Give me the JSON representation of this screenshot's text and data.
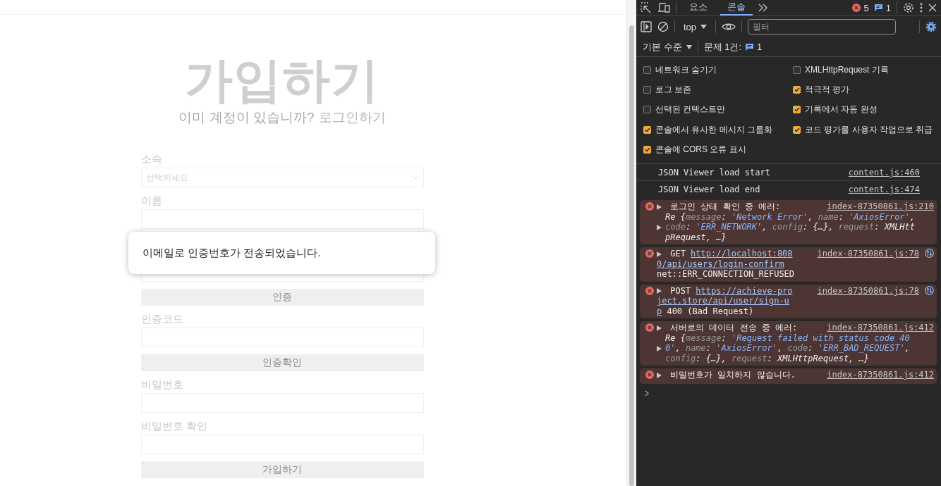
{
  "page": {
    "title": "가입하기",
    "subtitle": "이미 계정이 있습니까?",
    "login_link": "로그인하기",
    "form": [
      {
        "kind": "select",
        "label": "소속",
        "placeholder": "선택하세요"
      },
      {
        "kind": "input",
        "label": "이름"
      },
      {
        "kind": "input"
      },
      {
        "kind": "button",
        "label": "인증"
      },
      {
        "kind": "input",
        "label": "인증코드"
      },
      {
        "kind": "button",
        "label": "인증확인"
      },
      {
        "kind": "input",
        "label": "비밀번호"
      },
      {
        "kind": "input",
        "label": "비밀번호 확인"
      },
      {
        "kind": "button",
        "label": "가입하기"
      }
    ],
    "toast": {
      "message": "이메일로 인증번호가 전송되었습니다."
    }
  },
  "devtools": {
    "tabs": [
      {
        "label": "요소",
        "selected": false
      },
      {
        "label": "콘솔",
        "selected": true
      }
    ],
    "error_count": "5",
    "issue_count": "1",
    "context": "top",
    "filter": {
      "placeholder": "필터"
    },
    "level_menu": "기본 수준",
    "issues_label": "문제 1건:",
    "issues_count": "1",
    "settings": [
      {
        "label": "네트워크 숨기기",
        "checked": false
      },
      {
        "label": "XMLHttpRequest 기록",
        "checked": false
      },
      {
        "label": "로그 보존",
        "checked": false
      },
      {
        "label": "적극적 평가",
        "checked": true
      },
      {
        "label": "선택된 컨텍스트만",
        "checked": false
      },
      {
        "label": "기록에서 자동 완성",
        "checked": true
      },
      {
        "label": "콘솔에서 유사한 메시지 그룹화",
        "checked": true
      },
      {
        "label": "코드 평가를 사용자 작업으로 취급",
        "checked": true
      },
      {
        "label": "콘솔에 CORS 오류 표시",
        "checked": true
      }
    ],
    "messages": [
      {
        "kind": "info",
        "text": "JSON Viewer load start",
        "source": "content.js:460"
      },
      {
        "kind": "info",
        "text": "JSON Viewer load end",
        "source": "content.js:474"
      },
      {
        "kind": "error",
        "source": "index-87350861.js:210",
        "network": false,
        "lines": [
          {
            "kind": "head",
            "expander": true,
            "segments": [
              {
                "kind": "text",
                "text": "로그인 상태 확인 중 에러:"
              }
            ]
          },
          {
            "kind": "object",
            "expander": false,
            "segments": [
              {
                "kind": "value",
                "text": "Re {"
              },
              {
                "kind": "key",
                "text": "message"
              },
              {
                "kind": "value",
                "text": ": "
              },
              {
                "kind": "string",
                "text": "'Network Error'"
              },
              {
                "kind": "value",
                "text": ", "
              },
              {
                "kind": "key",
                "text": "name"
              },
              {
                "kind": "value",
                "text": ": "
              },
              {
                "kind": "string",
                "text": "'AxiosError'"
              },
              {
                "kind": "value",
                "text": ","
              }
            ]
          },
          {
            "kind": "object",
            "expander": true,
            "segments": [
              {
                "kind": "key",
                "text": "code"
              },
              {
                "kind": "value",
                "text": ": "
              },
              {
                "kind": "string",
                "text": "'ERR_NETWORK'"
              },
              {
                "kind": "value",
                "text": ", "
              },
              {
                "kind": "key",
                "text": "config"
              },
              {
                "kind": "value",
                "text": ": {…}, "
              },
              {
                "kind": "key",
                "text": "request"
              },
              {
                "kind": "value",
                "text": ": XMLHtt"
              }
            ]
          },
          {
            "kind": "object",
            "expander": false,
            "segments": [
              {
                "kind": "value",
                "text": "pRequest, …}"
              }
            ]
          }
        ]
      },
      {
        "kind": "error",
        "source": "index-87350861.js:78",
        "network": true,
        "lines": [
          {
            "kind": "head",
            "expander": true,
            "segments": [
              {
                "kind": "text",
                "text": "GET"
              },
              {
                "kind": "link",
                "text": "http://localhost:808"
              }
            ]
          },
          {
            "kind": "text",
            "segments": [
              {
                "kind": "link",
                "text": "0/api/users/login-confirm"
              }
            ]
          },
          {
            "kind": "text",
            "segments": [
              {
                "kind": "text",
                "text": "net::ERR_CONNECTION_REFUSED"
              }
            ]
          }
        ]
      },
      {
        "kind": "error",
        "source": "index-87350861.js:78",
        "network": true,
        "lines": [
          {
            "kind": "head",
            "expander": true,
            "segments": [
              {
                "kind": "text",
                "text": "POST"
              },
              {
                "kind": "link",
                "text": "https://achieve-pro"
              }
            ]
          },
          {
            "kind": "text",
            "segments": [
              {
                "kind": "link",
                "text": "ject.store/api/user/sign-u"
              }
            ]
          },
          {
            "kind": "text",
            "segments": [
              {
                "kind": "link",
                "text": "p"
              },
              {
                "kind": "text",
                "text": "400 (Bad Request)"
              }
            ]
          }
        ]
      },
      {
        "kind": "error",
        "source": "index-87350861.js:412",
        "network": false,
        "lines": [
          {
            "kind": "head",
            "expander": true,
            "segments": [
              {
                "kind": "text",
                "text": "서버로의 데이터 전송 중 에러:"
              }
            ]
          },
          {
            "kind": "object",
            "expander": false,
            "segments": [
              {
                "kind": "value",
                "text": "Re {"
              },
              {
                "kind": "key",
                "text": "message"
              },
              {
                "kind": "value",
                "text": ": "
              },
              {
                "kind": "string",
                "text": "'Request failed with status code 40"
              }
            ]
          },
          {
            "kind": "object",
            "expander": true,
            "segments": [
              {
                "kind": "string",
                "text": "0'"
              },
              {
                "kind": "value",
                "text": ", "
              },
              {
                "kind": "key",
                "text": "name"
              },
              {
                "kind": "value",
                "text": ": "
              },
              {
                "kind": "string",
                "text": "'AxiosError'"
              },
              {
                "kind": "value",
                "text": ", "
              },
              {
                "kind": "key",
                "text": "code"
              },
              {
                "kind": "value",
                "text": ": "
              },
              {
                "kind": "string",
                "text": "'ERR_BAD_REQUEST'"
              },
              {
                "kind": "value",
                "text": ","
              }
            ]
          },
          {
            "kind": "object",
            "expander": false,
            "segments": [
              {
                "kind": "key",
                "text": "config"
              },
              {
                "kind": "value",
                "text": ": {…}, "
              },
              {
                "kind": "key",
                "text": "request"
              },
              {
                "kind": "value",
                "text": ": XMLHttpRequest, …}"
              }
            ]
          }
        ]
      },
      {
        "kind": "error",
        "source": "index-87350861.js:412",
        "network": false,
        "lines": [
          {
            "kind": "head",
            "expander": true,
            "segments": [
              {
                "kind": "text",
                "text": "비밀번호가 일치하지 않습니다."
              }
            ]
          }
        ]
      }
    ]
  }
}
